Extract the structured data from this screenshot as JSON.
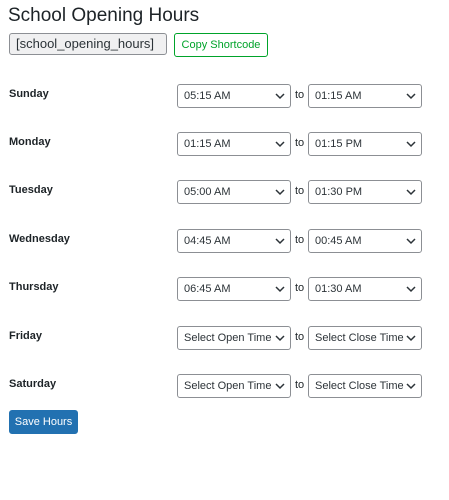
{
  "page": {
    "title": "School Opening Hours",
    "shortcode": "[school_opening_hours]",
    "copy_label": "Copy Shortcode",
    "save_label": "Save Hours",
    "to_label": "to"
  },
  "days": [
    {
      "name": "Sunday",
      "open": "05:15 AM",
      "close": "01:15 AM"
    },
    {
      "name": "Monday",
      "open": "01:15 AM",
      "close": "01:15 PM"
    },
    {
      "name": "Tuesday",
      "open": "05:00 AM",
      "close": "01:30 PM"
    },
    {
      "name": "Wednesday",
      "open": "04:45 AM",
      "close": "00:45 AM"
    },
    {
      "name": "Thursday",
      "open": "06:45 AM",
      "close": "01:30 AM"
    },
    {
      "name": "Friday",
      "open": "Select Open Time",
      "close": "Select Close Time"
    },
    {
      "name": "Saturday",
      "open": "Select Open Time",
      "close": "Select Close Time"
    }
  ],
  "icons": {
    "dropdown": "chevron-down-icon"
  },
  "colors": {
    "primary": "#2271b1",
    "success": "#00a32a",
    "border": "#8c8f94"
  }
}
